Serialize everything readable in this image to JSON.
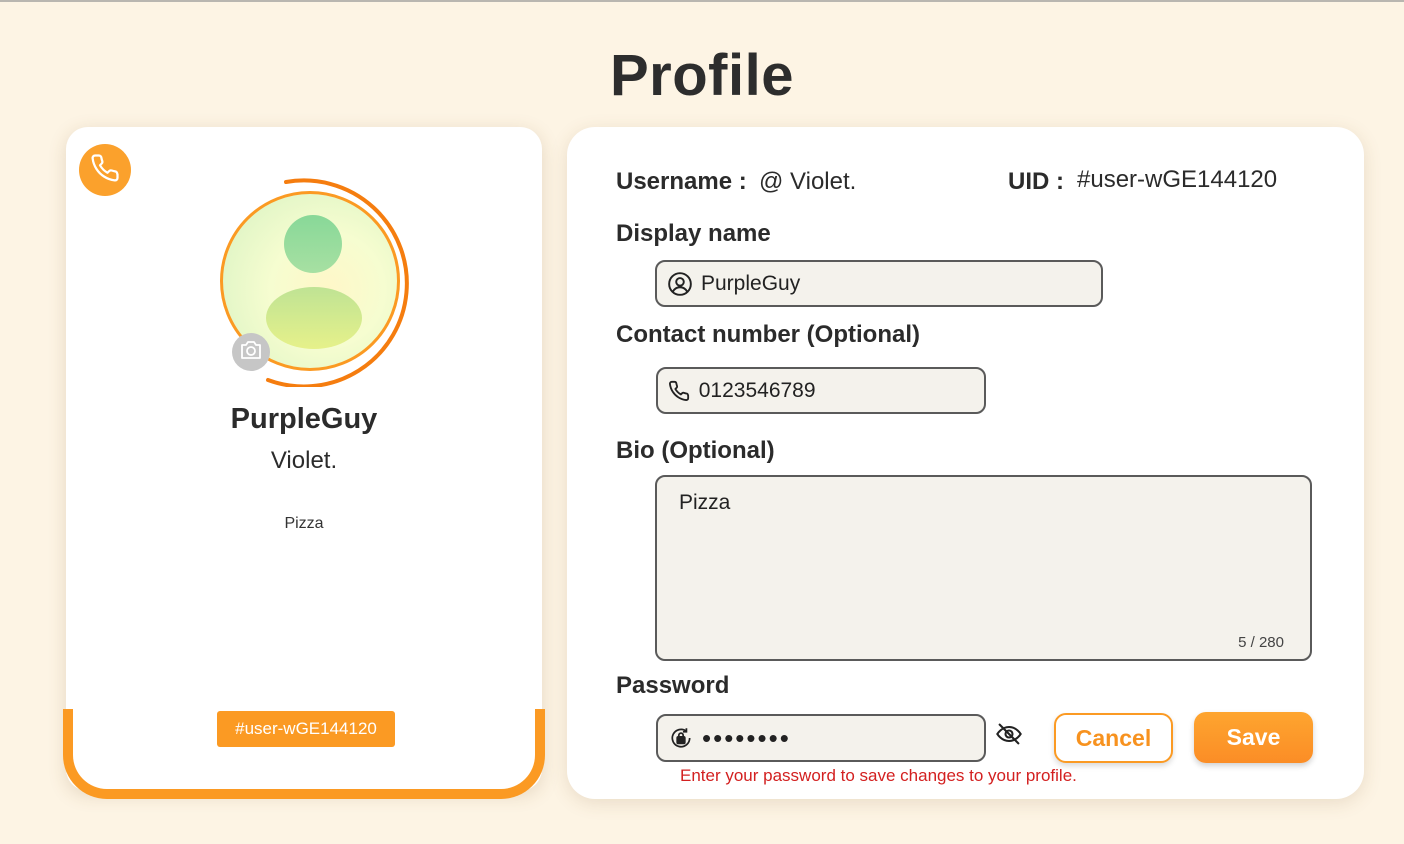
{
  "page": {
    "title": "Profile"
  },
  "card": {
    "display_name": "PurpleGuy",
    "username": "Violet.",
    "bio": "Pizza",
    "uid": "#user-wGE144120"
  },
  "form": {
    "username_label": "Username :",
    "username_value": "@ Violet.",
    "uid_label": "UID :",
    "uid_value": "#user-wGE144120",
    "display_name_label": "Display name",
    "display_name_value": "PurpleGuy",
    "contact_label": "Contact number (Optional)",
    "contact_value": "0123546789",
    "bio_label": "Bio (Optional)",
    "bio_value": "Pizza",
    "bio_count": "5 / 280",
    "password_label": "Password",
    "password_value": "••••••••",
    "password_hint": "Enter your password to save changes to your profile.",
    "cancel_label": "Cancel",
    "save_label": "Save"
  },
  "icons": {
    "phone_badge": "phone-icon",
    "camera": "camera-icon",
    "user_circle": "user-circle-icon",
    "phone": "phone-icon",
    "lock": "lock-icon",
    "eye_off": "eye-off-icon"
  },
  "colors": {
    "accent": "#fb9a23",
    "background": "#fdf4e4",
    "error": "#d32020"
  }
}
